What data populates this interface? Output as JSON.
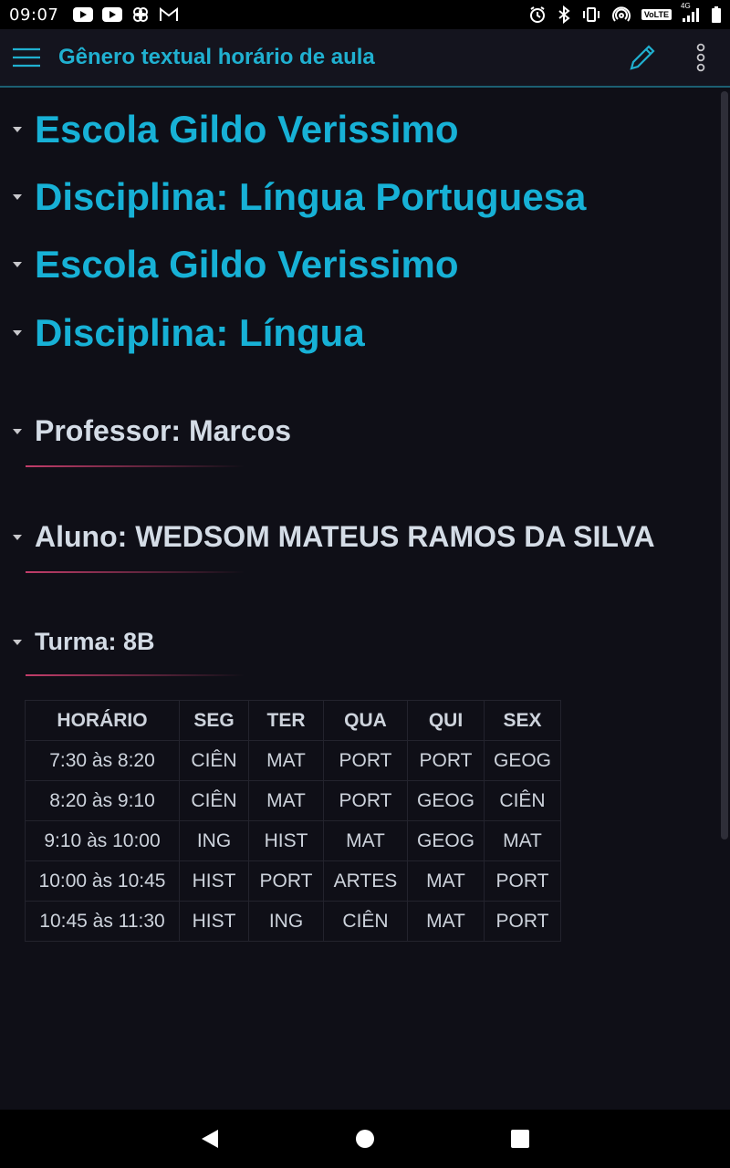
{
  "status_bar": {
    "time": "09:07",
    "network_label": "VoLTE",
    "network_gen": "4G"
  },
  "app_bar": {
    "title": "Gênero textual horário de aula"
  },
  "headings": [
    {
      "text": "Escola Gildo Verissimo",
      "level": 1
    },
    {
      "text": "Disciplina: Língua Portuguesa",
      "level": 1
    },
    {
      "text": "Escola Gildo Verissimo",
      "level": 1
    },
    {
      "text": "Disciplina: Língua",
      "level": 1
    },
    {
      "text": "Professor: Marcos",
      "level": 2
    },
    {
      "text": "Aluno: WEDSOM MATEUS RAMOS DA SILVA",
      "level": 2
    },
    {
      "text": "Turma: 8B",
      "level": 3
    }
  ],
  "schedule": {
    "columns": [
      "HORÁRIO",
      "SEG",
      "TER",
      "QUA",
      "QUI",
      "SEX"
    ],
    "rows": [
      [
        "7:30 às 8:20",
        "CIÊN",
        "MAT",
        "PORT",
        "PORT",
        "GEOG"
      ],
      [
        "8:20 às 9:10",
        "CIÊN",
        "MAT",
        "PORT",
        "GEOG",
        "CIÊN"
      ],
      [
        "9:10 às 10:00",
        "ING",
        "HIST",
        "MAT",
        "GEOG",
        "MAT"
      ],
      [
        "10:00 às 10:45",
        "HIST",
        "PORT",
        "ARTES",
        "MAT",
        "PORT"
      ],
      [
        "10:45 às 11:30",
        "HIST",
        "ING",
        "CIÊN",
        "MAT",
        "PORT"
      ]
    ]
  },
  "colors": {
    "accent": "#17b1d6",
    "rule": "#c23d6a",
    "background": "#0f0f17"
  },
  "icons": {
    "menu": "hamburger-icon",
    "edit": "pencil-icon",
    "more": "more-vertical-icon",
    "back": "back-triangle-icon",
    "home": "home-circle-icon",
    "recents": "recents-square-icon"
  }
}
